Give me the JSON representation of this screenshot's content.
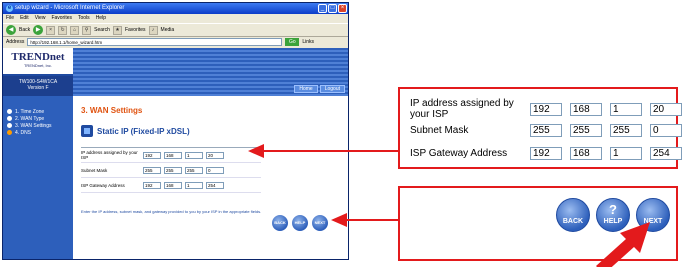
{
  "browser": {
    "title": "setup wizard - Microsoft Internet Explorer",
    "menu": [
      "File",
      "Edit",
      "View",
      "Favorites",
      "Tools",
      "Help"
    ],
    "back_label": "Back",
    "search_label": "Search",
    "favorites_label": "Favorites",
    "media_label": "Media",
    "address_label": "Address",
    "address_value": "http://192.168.1.1/home_wizard.htm",
    "go_label": "Go",
    "links_label": "Links"
  },
  "sidebar": {
    "logo": "TRENDnet",
    "logo_sub": "TRENDnet, Inc.",
    "model": "TW100-S4W1CA",
    "version": "Version F",
    "steps": [
      {
        "label": "1. Time Zone",
        "active": false
      },
      {
        "label": "2. WAN Type",
        "active": false
      },
      {
        "label": "3. WAN Settings",
        "active": false
      },
      {
        "label": "4. DNS",
        "active": true
      }
    ]
  },
  "header": {
    "home_label": "Home",
    "logout_label": "Logout"
  },
  "page": {
    "title": "3. WAN Settings",
    "section": "Static IP (Fixed-IP xDSL)",
    "note": "Enter the IP address, subnet mask, and gateway provided to you by your ISP in the appropriate fields."
  },
  "form": {
    "ip_label": "IP address assigned by your ISP",
    "ip": [
      "192",
      "168",
      "1",
      "20"
    ],
    "mask_label": "Subnet Mask",
    "mask": [
      "255",
      "255",
      "255",
      "0"
    ],
    "gw_label": "ISP Gateway Address",
    "gw": [
      "192",
      "168",
      "1",
      "254"
    ]
  },
  "buttons": {
    "back": "BACK",
    "help": "HELP",
    "next": "NEXT",
    "help_symbol": "?"
  },
  "colors": {
    "accent": "#2d5fbb",
    "title": "#e0520f",
    "callout": "#e31a1c"
  }
}
